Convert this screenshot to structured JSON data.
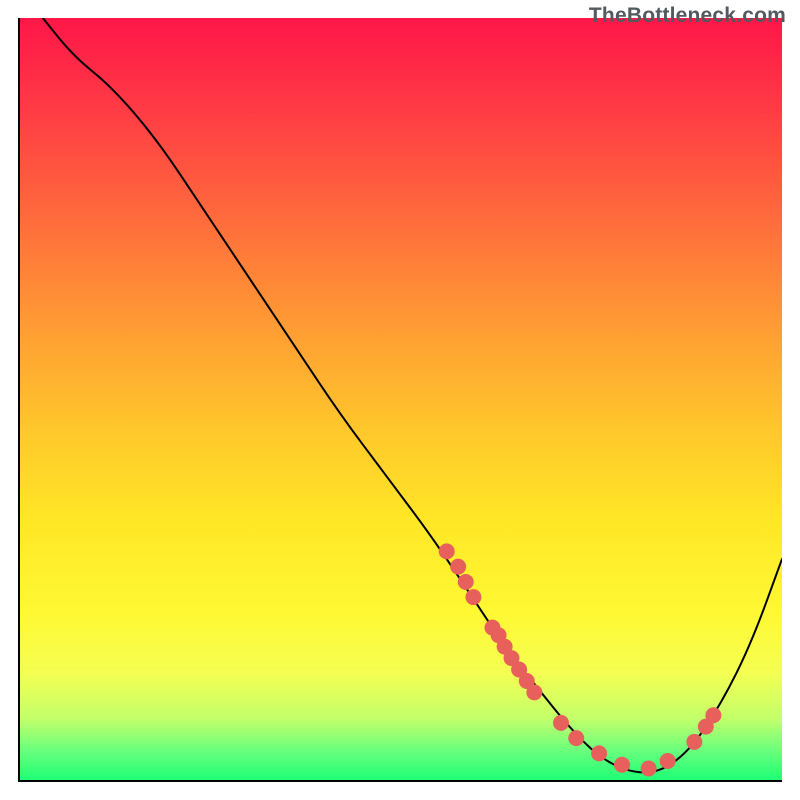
{
  "watermark": "TheBottleneck.com",
  "chart_data": {
    "type": "line",
    "title": "",
    "xlabel": "",
    "ylabel": "",
    "xlim": [
      0,
      100
    ],
    "ylim": [
      0,
      100
    ],
    "grid": false,
    "series": [
      {
        "name": "curve",
        "x": [
          3,
          7,
          12,
          18,
          24,
          30,
          36,
          42,
          48,
          54,
          60,
          64,
          68,
          72,
          76,
          80,
          84,
          88,
          92,
          96,
          100
        ],
        "values": [
          100,
          95,
          91,
          84,
          75,
          66,
          57,
          48,
          40,
          32,
          23,
          17,
          12,
          7,
          3,
          1,
          1,
          4,
          10,
          18,
          29
        ]
      }
    ],
    "markers": [
      {
        "x": 56,
        "y": 30
      },
      {
        "x": 57.5,
        "y": 28
      },
      {
        "x": 58.5,
        "y": 26
      },
      {
        "x": 59.5,
        "y": 24
      },
      {
        "x": 62,
        "y": 20
      },
      {
        "x": 62.8,
        "y": 19
      },
      {
        "x": 63.6,
        "y": 17.5
      },
      {
        "x": 64.5,
        "y": 16
      },
      {
        "x": 65.5,
        "y": 14.5
      },
      {
        "x": 66.5,
        "y": 13
      },
      {
        "x": 67.5,
        "y": 11.5
      },
      {
        "x": 71,
        "y": 7.5
      },
      {
        "x": 73,
        "y": 5.5
      },
      {
        "x": 76,
        "y": 3.5
      },
      {
        "x": 79,
        "y": 2
      },
      {
        "x": 82.5,
        "y": 1.5
      },
      {
        "x": 85,
        "y": 2.5
      },
      {
        "x": 88.5,
        "y": 5
      },
      {
        "x": 90,
        "y": 7
      },
      {
        "x": 91,
        "y": 8.5
      }
    ],
    "marker_style": {
      "color": "#e7605b",
      "radius_px": 8
    },
    "background_gradient": {
      "top": "#ff1648",
      "mid": "#ffe726",
      "bottom": "#1eff76"
    }
  }
}
